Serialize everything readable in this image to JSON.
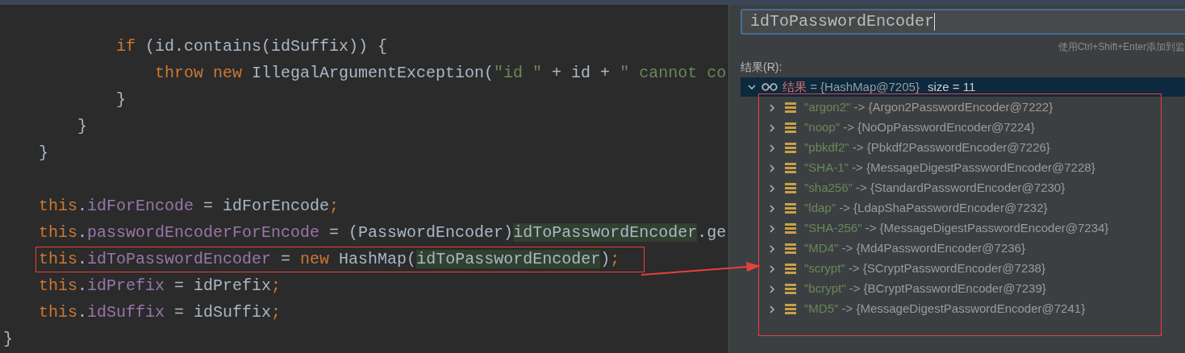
{
  "editor": {
    "lines": [
      {
        "children": [
          {
            "children": [
              {
                "children": [
                  {
                    "blank": true
                  },
                  {
                    "tokens": [
                      {
                        "kind": "keyword",
                        "text": "if "
                      },
                      {
                        "kind": "plain",
                        "text": "(id.contains(idSuffix)) {"
                      }
                    ],
                    "children": [
                      {
                        "tokens": [
                          {
                            "kind": "keyword",
                            "text": "throw new "
                          },
                          {
                            "kind": "plain",
                            "text": "IllegalArgumentException("
                          },
                          {
                            "kind": "string",
                            "text": "\"id \""
                          },
                          {
                            "kind": "plain",
                            "text": " + id + "
                          },
                          {
                            "kind": "string",
                            "text": "\" cannot co"
                          }
                        ]
                      }
                    ]
                  },
                  {
                    "tokens": [
                      {
                        "kind": "plain",
                        "text": "}"
                      }
                    ]
                  }
                ]
              },
              {
                "tokens": [
                  {
                    "kind": "plain",
                    "text": "}"
                  }
                ]
              }
            ]
          },
          {
            "tokens": [
              {
                "kind": "plain",
                "text": "}"
              }
            ]
          },
          {
            "blank": true
          },
          {
            "tokens": [
              {
                "kind": "keyword",
                "text": "this"
              },
              {
                "kind": "plain",
                "text": "."
              },
              {
                "kind": "field",
                "text": "idForEncode"
              },
              {
                "kind": "plain",
                "text": " = idForEncode"
              },
              {
                "kind": "keyword",
                "text": ";"
              }
            ]
          },
          {
            "tokens": [
              {
                "kind": "keyword",
                "text": "this"
              },
              {
                "kind": "plain",
                "text": "."
              },
              {
                "kind": "field",
                "text": "passwordEncoderForEncode"
              },
              {
                "kind": "plain",
                "text": " = (PasswordEncoder)"
              },
              {
                "kind": "match",
                "text": "idToPasswordEncoder"
              },
              {
                "kind": "plain",
                "text": ".ge"
              }
            ]
          },
          {
            "boxed": true,
            "tokens": [
              {
                "kind": "keyword",
                "text": "this"
              },
              {
                "kind": "plain",
                "text": "."
              },
              {
                "kind": "field",
                "text": "idToPasswordEncoder"
              },
              {
                "kind": "plain",
                "text": " = "
              },
              {
                "kind": "keyword",
                "text": "new "
              },
              {
                "kind": "plain",
                "text": "HashMap("
              },
              {
                "kind": "match",
                "text": "idToPasswordEncoder"
              },
              {
                "kind": "plain",
                "text": ")"
              },
              {
                "kind": "keyword",
                "text": ";"
              }
            ]
          },
          {
            "tokens": [
              {
                "kind": "keyword",
                "text": "this"
              },
              {
                "kind": "plain",
                "text": "."
              },
              {
                "kind": "field",
                "text": "idPrefix"
              },
              {
                "kind": "plain",
                "text": " = idPrefix"
              },
              {
                "kind": "keyword",
                "text": ";"
              }
            ]
          },
          {
            "tokens": [
              {
                "kind": "keyword",
                "text": "this"
              },
              {
                "kind": "plain",
                "text": "."
              },
              {
                "kind": "field",
                "text": "idSuffix"
              },
              {
                "kind": "plain",
                "text": " = idSuffix"
              },
              {
                "kind": "keyword",
                "text": ";"
              }
            ]
          }
        ]
      },
      {
        "tokens": [
          {
            "kind": "plain",
            "text": "}"
          }
        ]
      }
    ]
  },
  "evaluate": {
    "expression": "idToPasswordEncoder",
    "hint": "使用Ctrl+Shift+Enter添加到监",
    "result_label": "结果(R):",
    "root": {
      "expanded": true,
      "selected": true,
      "name": "结果",
      "value": " = {HashMap@7205}",
      "extra": "size = 11"
    },
    "entries": [
      {
        "key": "\"argon2\"",
        "value": " -> {Argon2PasswordEncoder@7222}",
        "expanded": false
      },
      {
        "key": "\"noop\"",
        "value": " -> {NoOpPasswordEncoder@7224}",
        "expanded": false
      },
      {
        "key": "\"pbkdf2\"",
        "value": " -> {Pbkdf2PasswordEncoder@7226}",
        "expanded": false
      },
      {
        "key": "\"SHA-1\"",
        "value": " -> {MessageDigestPasswordEncoder@7228}",
        "expanded": false
      },
      {
        "key": "\"sha256\"",
        "value": " -> {StandardPasswordEncoder@7230}",
        "expanded": false
      },
      {
        "key": "\"ldap\"",
        "value": " -> {LdapShaPasswordEncoder@7232}",
        "expanded": false
      },
      {
        "key": "\"SHA-256\"",
        "value": " -> {MessageDigestPasswordEncoder@7234}",
        "expanded": false
      },
      {
        "key": "\"MD4\"",
        "value": " -> {Md4PasswordEncoder@7236}",
        "expanded": false
      },
      {
        "key": "\"scrypt\"",
        "value": " -> {SCryptPasswordEncoder@7238}",
        "expanded": false
      },
      {
        "key": "\"bcrypt\"",
        "value": " -> {BCryptPasswordEncoder@7239}",
        "expanded": false
      },
      {
        "key": "\"MD5\"",
        "value": " -> {MessageDigestPasswordEncoder@7241}",
        "expanded": false
      }
    ],
    "entries_boxed": true
  }
}
